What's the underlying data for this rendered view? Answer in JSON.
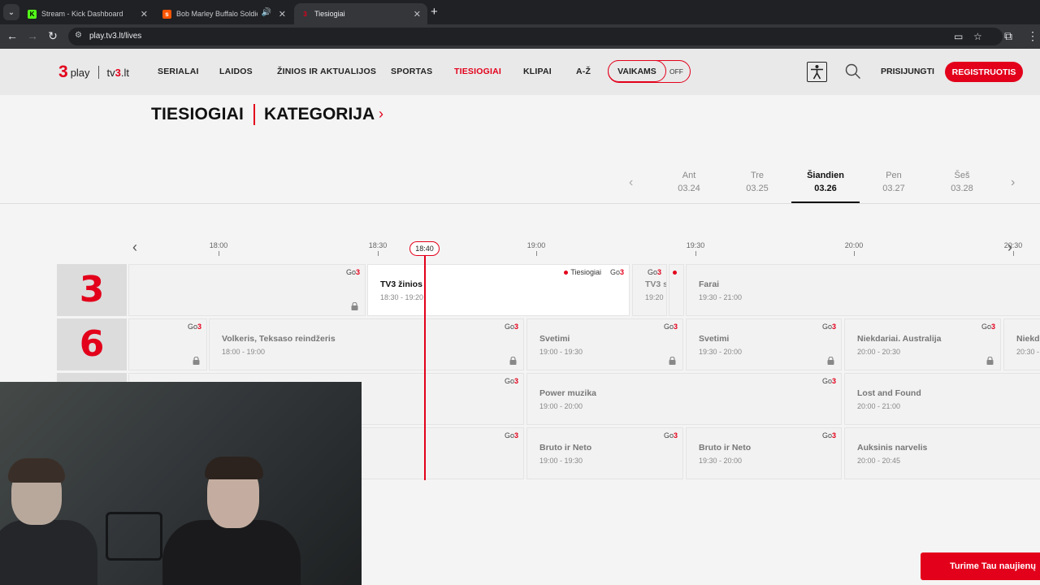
{
  "browser": {
    "tabs": [
      {
        "title": "Stream - Kick Dashboard",
        "favicon": "K",
        "favicon_color": "#53fc18",
        "active": false
      },
      {
        "title": "Bob Marley Buffalo Soldier",
        "favicon": "s",
        "favicon_color": "#ff5500",
        "active": false,
        "audio": true
      },
      {
        "title": "Tiesiogiai",
        "favicon": "3",
        "favicon_color": "#e3001b",
        "active": true
      }
    ],
    "url": "play.tv3.lt/lives"
  },
  "header": {
    "logo_play": "play",
    "logo_tv3": "tv3.lt",
    "nav": [
      {
        "label": "SERIALAI",
        "active": false
      },
      {
        "label": "LAIDOS",
        "active": false
      },
      {
        "label": "ŽINIOS IR AKTUALIJOS",
        "active": false
      },
      {
        "label": "SPORTAS",
        "active": false
      },
      {
        "label": "TIESIOGIAI",
        "active": true
      },
      {
        "label": "KLIPAI",
        "active": false
      },
      {
        "label": "A-Ž",
        "active": false
      }
    ],
    "kids_label": "VAIKAMS",
    "kids_state": "OFF",
    "login_label": "PRISIJUNGTI",
    "register_label": "REGISTRUOTIS"
  },
  "page": {
    "title": "TIESIOGIAI",
    "category": "KATEGORIJA"
  },
  "dates": [
    {
      "name": "Ant",
      "date": "03.24",
      "active": false
    },
    {
      "name": "Tre",
      "date": "03.25",
      "active": false
    },
    {
      "name": "Šiandien",
      "date": "03.26",
      "active": true
    },
    {
      "name": "Pen",
      "date": "03.27",
      "active": false
    },
    {
      "name": "Šeš",
      "date": "03.28",
      "active": false
    }
  ],
  "timeline": {
    "times": [
      "18:00",
      "18:30",
      "19:00",
      "19:30",
      "20:00",
      "20:30"
    ],
    "now": "18:40"
  },
  "schedule": {
    "go3_label": "Go",
    "live_label": "Tiesiogiai",
    "channels": [
      {
        "logo": "3",
        "programs": [
          {
            "title": "",
            "time": "",
            "locked": true
          },
          {
            "title": "TV3 žinios",
            "time": "18:30 - 19:20",
            "live": true
          },
          {
            "title": "TV3 s",
            "time": "19:20",
            "live": false
          },
          {
            "title": "",
            "time": "",
            "live": false
          },
          {
            "title": "Farai",
            "time": "19:30 - 21:00"
          }
        ]
      },
      {
        "logo": "6",
        "programs": [
          {
            "title": "",
            "time": "",
            "locked": true
          },
          {
            "title": "Volkeris, Teksaso reindžeris",
            "time": "18:00 - 19:00",
            "locked": true
          },
          {
            "title": "Svetimi",
            "time": "19:00 - 19:30",
            "locked": true
          },
          {
            "title": "Svetimi",
            "time": "19:30 - 20:00",
            "locked": true
          },
          {
            "title": "Niekdariai. Australija",
            "time": "20:00 - 20:30",
            "locked": true
          },
          {
            "title": "Niekd",
            "time": "20:30 -"
          }
        ]
      },
      {
        "logo": "",
        "programs": [
          {
            "title": "",
            "time": ""
          },
          {
            "title": "Power muzika",
            "time": "19:00 - 20:00"
          },
          {
            "title": "Lost and Found",
            "time": "20:00 - 21:00"
          }
        ]
      },
      {
        "logo": "",
        "programs": [
          {
            "title": "",
            "time": ""
          },
          {
            "title": "Bruto ir Neto",
            "time": "19:00 - 19:30"
          },
          {
            "title": "Bruto ir Neto",
            "time": "19:30 - 20:00"
          },
          {
            "title": "Auksinis narvelis",
            "time": "20:00 - 20:45"
          }
        ]
      }
    ]
  },
  "promo": {
    "label": "Turime Tau naujienų"
  },
  "colors": {
    "brand": "#e3001b"
  }
}
